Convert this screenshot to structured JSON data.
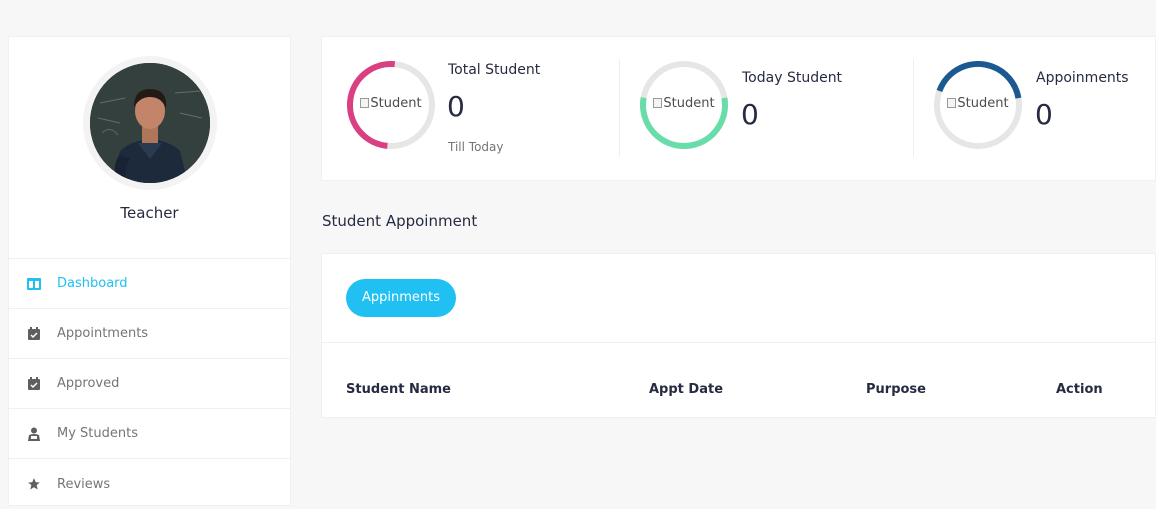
{
  "profile": {
    "name": "Teacher"
  },
  "sidebar": {
    "items": [
      {
        "label": "Dashboard",
        "icon": "dashboard-icon",
        "active": true
      },
      {
        "label": "Appointments",
        "icon": "calendar-check-icon",
        "active": false
      },
      {
        "label": "Approved",
        "icon": "calendar-check-icon",
        "active": false
      },
      {
        "label": "My Students",
        "icon": "students-icon",
        "active": false
      },
      {
        "label": "Reviews",
        "icon": "star-icon",
        "active": false
      }
    ]
  },
  "stats": [
    {
      "title": "Total Student",
      "value": "0",
      "sub": "Till Today",
      "img_alt": "Student",
      "ring_color": "#da3f81"
    },
    {
      "title": "Today Student",
      "value": "0",
      "sub": "",
      "img_alt": "Student",
      "ring_color": "#68dda9"
    },
    {
      "title": "Appoinments",
      "value": "0",
      "sub": "",
      "img_alt": "Student",
      "ring_color": "#1b5a90"
    }
  ],
  "section": {
    "title": "Student Appoinment"
  },
  "appointments": {
    "tab_label": "Appinments",
    "columns": [
      "Student Name",
      "Appt Date",
      "Purpose",
      "Action"
    ],
    "rows": []
  },
  "colors": {
    "accent": "#20c0f3",
    "text": "#272b41",
    "muted": "#757575"
  }
}
